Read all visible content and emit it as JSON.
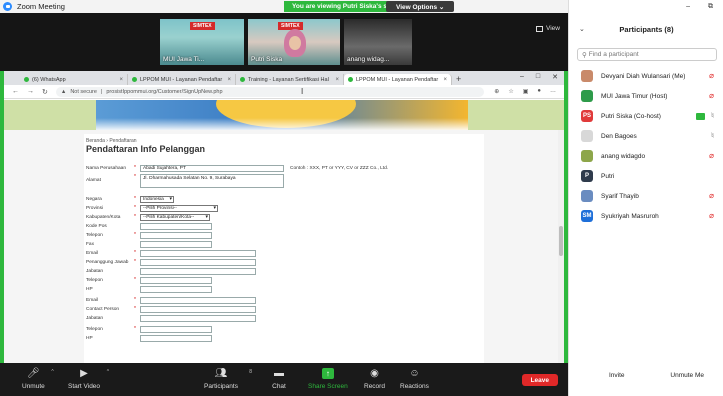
{
  "zoom": {
    "window_title": "Zoom Meeting",
    "banner": "You are viewing Putri Siska's screen",
    "view_options": "View Options ⌄",
    "view_label": "View"
  },
  "thumbnails": [
    {
      "name": "MUI Jawa Ti...",
      "overlay": "SIMTEX"
    },
    {
      "name": "Putri Siska",
      "overlay": "SIMTEX"
    },
    {
      "name": "anang widag..."
    }
  ],
  "browser": {
    "tabs": [
      {
        "label": "(6) WhatsApp"
      },
      {
        "label": "LPPOM MUI - Layanan Pendaftar"
      },
      {
        "label": "Training - Layanan Sertifikasi Hal"
      },
      {
        "label": "LPPOM MUI - Layanan Pendaftar"
      }
    ],
    "address_warning": "Not secure",
    "url": "prosistIppommui.org/Customer/SignUpNew.php"
  },
  "form": {
    "breadcrumb": "Beranda › Pendaftaran",
    "title": "Pendaftaran Info Pelanggan",
    "company_label": "Nama Perusahaan",
    "company_value": "Abadi Sujahtera, PT",
    "company_hint": "Contoh : XXX, PT or YYY, CV or ZZZ Co., Ltd.",
    "address_label": "Alamat",
    "address_value": "Jl. Dharmahusada Selatan No. 9, Surabaya",
    "country_label": "Negara",
    "country_value": "Indonesia",
    "province_label": "Provinsi",
    "province_value": "--Pilih Provinsi--",
    "city_label": "Kabupaten/Kota",
    "city_value": "--Pilih Kabupaten/Kota--",
    "postal_label": "Kode Pos",
    "phone_label": "Telepon",
    "fax_label": "Fax",
    "email_label": "Email",
    "pic_label": "Penanggung Jawab",
    "position_label": "Jabatan",
    "phone2_label": "Telepon",
    "hp_label": "HP",
    "email2_label": "Email",
    "contact_label": "Contact Person",
    "position2_label": "Jabatan",
    "phone3_label": "Telepon",
    "hp2_label": "HP"
  },
  "controls": {
    "unmute": "Unmute",
    "start_video": "Start Video",
    "participants": "Participants",
    "participants_count": "8",
    "chat": "Chat",
    "share_screen": "Share Screen",
    "record": "Record",
    "reactions": "Reactions",
    "leave": "Leave"
  },
  "panel": {
    "title": "Participants (8)",
    "search_placeholder": "Find a participant",
    "participants": [
      {
        "name": "Devyani Diah Wulansari (Me)",
        "initials": "",
        "color": "#c98a6a",
        "status": "muted"
      },
      {
        "name": "MUI Jawa Timur (Host)",
        "initials": "",
        "color": "#2e9b4a",
        "status": "muted"
      },
      {
        "name": "Putri Siska (Co-host)",
        "initials": "PS",
        "color": "#e03a3a",
        "status": "video-mic"
      },
      {
        "name": "Den Bagoes",
        "initials": "",
        "color": "#d8d8d8",
        "status": "mic"
      },
      {
        "name": "anang widagdo",
        "initials": "",
        "color": "#8da64a",
        "status": "muted"
      },
      {
        "name": "Putri",
        "initials": "P",
        "color": "#2f3b4c",
        "status": "none"
      },
      {
        "name": "Syarif Thayib",
        "initials": "",
        "color": "#6a8cc0",
        "status": "muted"
      },
      {
        "name": "Syukriyah Masruroh",
        "initials": "SM",
        "color": "#1e6fd9",
        "status": "muted"
      }
    ],
    "invite": "Invite",
    "unmute_me": "Unmute Me"
  }
}
